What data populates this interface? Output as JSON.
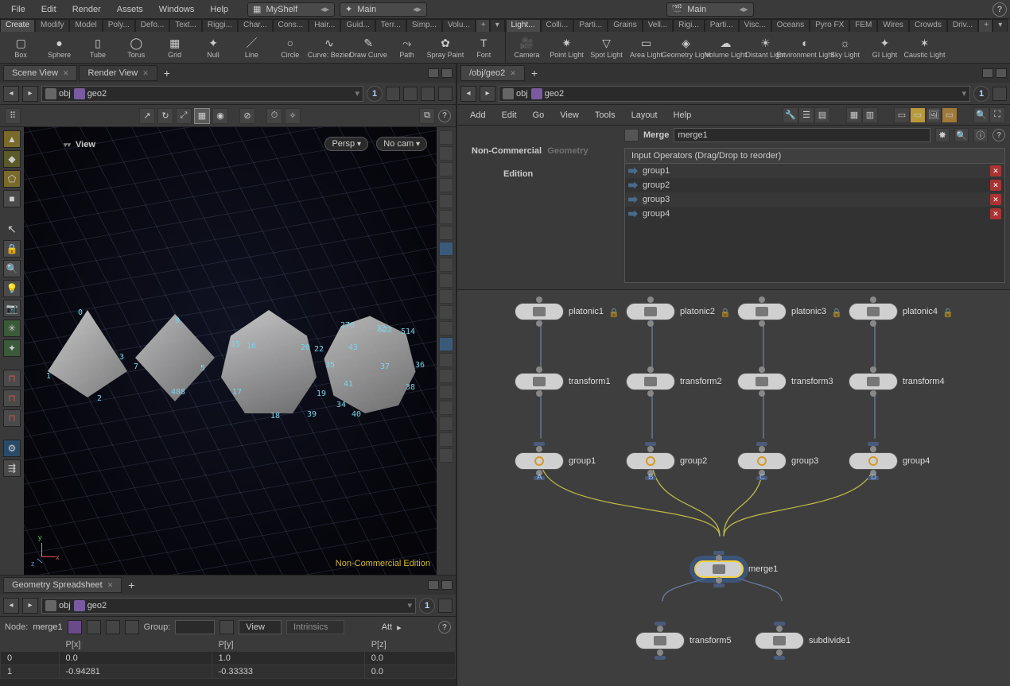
{
  "menus": {
    "file": "File",
    "edit": "Edit",
    "render": "Render",
    "assets": "Assets",
    "windows": "Windows",
    "help": "Help"
  },
  "shelf_left_sel": "MyShelf",
  "shelf_right_sel": "Main",
  "desktop_sel": "Main",
  "shelf_left_tabs": [
    "Create",
    "Modify",
    "Model",
    "Poly...",
    "Defo...",
    "Text...",
    "Riggi...",
    "Char...",
    "Cons...",
    "Hair...",
    "Guid...",
    "Terr...",
    "Simp...",
    "Volu..."
  ],
  "shelf_right_tabs": [
    "Light...",
    "Colli...",
    "Parti...",
    "Grains",
    "Vell...",
    "Rigi...",
    "Parti...",
    "Visc...",
    "Oceans",
    "Pyro FX",
    "FEM",
    "Wires",
    "Crowds",
    "Driv..."
  ],
  "tools_left": [
    {
      "l": "Box",
      "i": "▢"
    },
    {
      "l": "Sphere",
      "i": "●"
    },
    {
      "l": "Tube",
      "i": "▯"
    },
    {
      "l": "Torus",
      "i": "◯"
    },
    {
      "l": "Grid",
      "i": "▦"
    },
    {
      "l": "Null",
      "i": "✦"
    },
    {
      "l": "Line",
      "i": "／"
    },
    {
      "l": "Circle",
      "i": "○"
    },
    {
      "l": "Curve: Bezier",
      "i": "∿"
    },
    {
      "l": "Draw Curve",
      "i": "✎"
    },
    {
      "l": "Path",
      "i": "⤳"
    },
    {
      "l": "Spray Paint",
      "i": "✿"
    },
    {
      "l": "Font",
      "i": "T"
    }
  ],
  "tools_right": [
    {
      "l": "Camera",
      "i": "🎥"
    },
    {
      "l": "Point Light",
      "i": "✷"
    },
    {
      "l": "Spot Light",
      "i": "▽"
    },
    {
      "l": "Area Light",
      "i": "▭"
    },
    {
      "l": "Geometry Light",
      "i": "◈"
    },
    {
      "l": "Volume Light",
      "i": "☁"
    },
    {
      "l": "Distant Light",
      "i": "☀"
    },
    {
      "l": "Environment Light",
      "i": "◐"
    },
    {
      "l": "Sky Light",
      "i": "☼"
    },
    {
      "l": "GI Light",
      "i": "✦"
    },
    {
      "l": "Caustic Light",
      "i": "✶"
    }
  ],
  "left_tabs": {
    "scene": "Scene View",
    "render": "Render View"
  },
  "path": {
    "root": "obj",
    "leaf": "geo2"
  },
  "pin": "1",
  "viewport": {
    "label": "View",
    "persp": "Persp",
    "nocam": "No cam",
    "watermark": "Non-Commercial Edition",
    "axes": {
      "x": "x",
      "y": "y",
      "z": "z"
    },
    "nums": [
      "0",
      "1",
      "2",
      "3",
      "5",
      "7",
      "9",
      "15",
      "16",
      "17",
      "18",
      "19",
      "20",
      "22",
      "276",
      "32",
      "34",
      "35",
      "36",
      "37",
      "38",
      "39",
      "40",
      "41",
      "43",
      "488",
      "522",
      "514"
    ]
  },
  "spreadsheet": {
    "tab": "Geometry Spreadsheet",
    "node_label": "Node:",
    "node": "merge1",
    "group_label": "Group:",
    "view": "View",
    "intrinsics": "Intrinsics",
    "att": "Att",
    "cols": [
      "",
      "P[x]",
      "P[y]",
      "P[z]"
    ],
    "rows": [
      [
        "0",
        "0.0",
        "1.0",
        "0.0"
      ],
      [
        "1",
        "-0.94281",
        "-0.33333",
        "0.0"
      ]
    ]
  },
  "right_tab": "/obj/geo2",
  "net_menus": {
    "add": "Add",
    "edit": "Edit",
    "go": "Go",
    "view": "View",
    "tools": "Tools",
    "layout": "Layout",
    "help": "Help"
  },
  "param": {
    "type": "Merge",
    "name": "merge1",
    "inputs_hdr": "Input Operators (Drag/Drop to reorder)",
    "inputs": [
      "group1",
      "group2",
      "group3",
      "group4"
    ]
  },
  "wm2a": "Non-Commercial",
  "wm2b": "Edition",
  "wm2c": "Geometry",
  "nodes": {
    "platonic": [
      "platonic1",
      "platonic2",
      "platonic3",
      "platonic4"
    ],
    "transform": [
      "transform1",
      "transform2",
      "transform3",
      "transform4"
    ],
    "group": [
      "group1",
      "group2",
      "group3",
      "group4"
    ],
    "group_sub": [
      "A",
      "B",
      "C",
      "D"
    ],
    "merge": "merge1",
    "transform5": "transform5",
    "subdivide": "subdivide1"
  }
}
